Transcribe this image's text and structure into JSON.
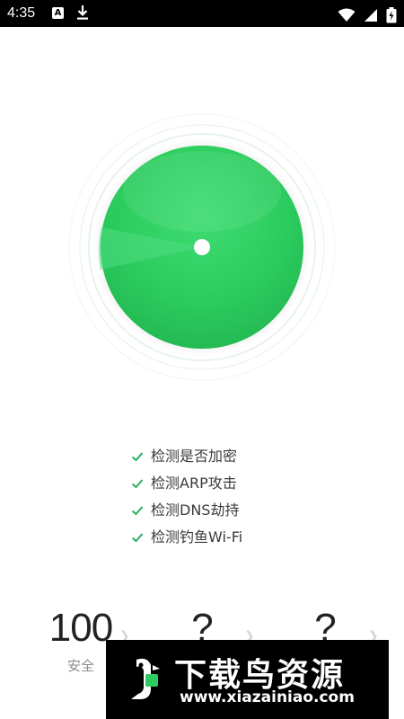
{
  "status_bar": {
    "time": "4:35",
    "notification_a": "A",
    "icons": [
      "download-icon",
      "wifi-icon",
      "signal-icon",
      "battery-icon"
    ]
  },
  "scan": {
    "state": "scanning",
    "colors": {
      "dial": "#2ecc60",
      "dial_dark": "#23b84f",
      "ring": "#e8f3ec"
    }
  },
  "checklist": [
    {
      "label": "检测是否加密"
    },
    {
      "label": "检测ARP攻击"
    },
    {
      "label": "检测DNS劫持"
    },
    {
      "label": "检测钓鱼Wi-Fi"
    }
  ],
  "check_color": "#27ae60",
  "stats": [
    {
      "value": "100",
      "label": "安全"
    },
    {
      "value": "?",
      "label": ""
    },
    {
      "value": "?",
      "label": ""
    }
  ],
  "watermark": {
    "title": "下载鸟资源",
    "url": "www.xiazainiao.com"
  }
}
